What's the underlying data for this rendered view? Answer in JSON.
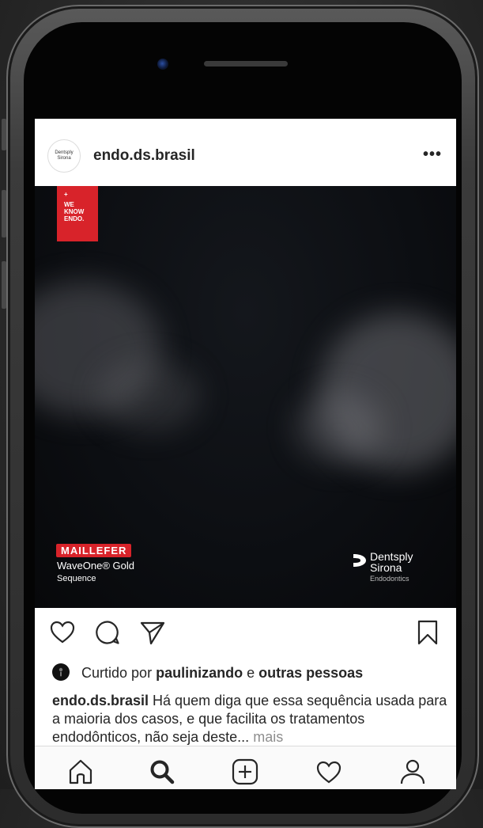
{
  "post": {
    "username": "endo.ds.brasil",
    "more_label": "•••",
    "avatar_label": "Dentsply Sirona"
  },
  "media": {
    "badge_lines": [
      "+",
      "WE",
      "KNOW",
      "ENDO."
    ],
    "brand_badge": "MAILLEFER",
    "product": "WaveOne® Gold",
    "product_sub": "Sequence",
    "logo_brand_line1": "Dentsply",
    "logo_brand_line2": "Sirona",
    "logo_sub": "Endodontics"
  },
  "likes": {
    "prefix": "Curtido por",
    "user": "paulinizando",
    "joiner": "e",
    "others": "outras pessoas"
  },
  "caption": {
    "author": "endo.ds.brasil",
    "text": "Há quem diga que essa sequência usada para a maioria dos casos, e que facilita os tratamentos endodônticos, não seja deste...",
    "more": "mais"
  },
  "icons": {
    "actions": [
      "heart-icon",
      "comment-icon",
      "share-icon",
      "bookmark-icon"
    ],
    "tabs": [
      "home-icon",
      "search-icon",
      "add-icon",
      "activity-icon",
      "profile-icon"
    ]
  }
}
